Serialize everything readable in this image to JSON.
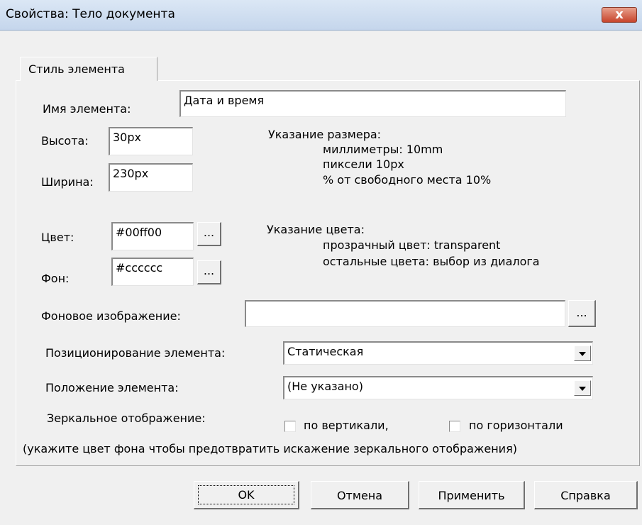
{
  "window": {
    "title": "Свойства: Тело документа",
    "close_label": "x"
  },
  "tab": {
    "label": "Стиль элемента"
  },
  "fields": {
    "name_label": "Имя элемента:",
    "name_value": "Дата и время",
    "height_label": "Высота:",
    "height_value": "30px",
    "width_label": "Ширина:",
    "width_value": "230px",
    "color_label": "Цвет:",
    "color_value": "#00ff00",
    "bg_label": "Фон:",
    "bg_value": "#cccccc",
    "browse_label": "...",
    "bg_image_label": "Фоновое изображение:",
    "bg_image_value": ""
  },
  "size_hint": {
    "heading": "Указание размера:",
    "line1": "миллиметры: 10mm",
    "line2": "пиксели 10px",
    "line3": "% от свободного места 10%"
  },
  "color_hint": {
    "heading": "Указание цвета:",
    "line1": "прозрачный цвет: transparent",
    "line2": "остальные цвета: выбор из диалога"
  },
  "positioning": {
    "label": "Позиционирование элемента:",
    "selected": "Статическая"
  },
  "placement": {
    "label": "Положение элемента:",
    "selected": "(Не указано)"
  },
  "mirror": {
    "label": "Зеркальное отображение:",
    "vertical_label": "по вертикали,",
    "vertical_checked": false,
    "horizontal_label": "по горизонтали",
    "horizontal_checked": false,
    "note": "(укажите цвет фона чтобы предотвратить искажение зеркального отображения)"
  },
  "buttons": {
    "ok": "OK",
    "cancel": "Отмена",
    "apply": "Применить",
    "help": "Справка"
  }
}
